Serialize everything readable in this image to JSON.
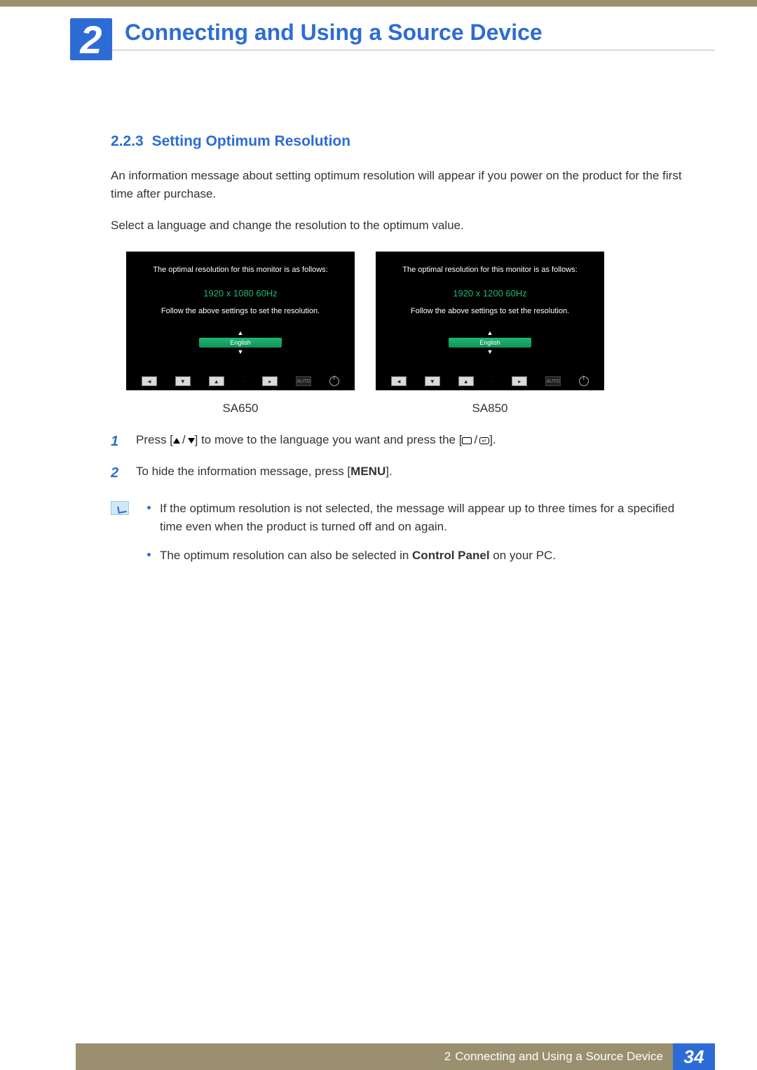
{
  "chapter": {
    "number": "2",
    "title": "Connecting and Using a Source Device"
  },
  "section": {
    "number": "2.2.3",
    "title": "Setting Optimum Resolution"
  },
  "paragraphs": {
    "p1": "An information message about setting optimum resolution will appear if you power on the product for the first time after purchase.",
    "p2": "Select a language and change the resolution to the optimum value."
  },
  "panels": [
    {
      "intro": "The optimal resolution for this monitor is as follows:",
      "resolution": "1920 x 1080  60Hz",
      "follow": "Follow the above settings to set the resolution.",
      "language": "English",
      "auto_label": "AUTO",
      "label": "SA650"
    },
    {
      "intro": "The optimal resolution for this monitor is as follows:",
      "resolution": "1920 x 1200  60Hz",
      "follow": "Follow the above settings to set the resolution.",
      "language": "English",
      "auto_label": "AUTO",
      "label": "SA850"
    }
  ],
  "steps": {
    "s1_pre": "Press [",
    "s1_mid": "] to move to the language you want and press the [",
    "s1_post": "].",
    "s2_pre": "To hide the information message, press [",
    "s2_menu": "MENU",
    "s2_post": "]."
  },
  "notes": {
    "n1": "If the optimum resolution is not selected, the message will appear up to three times for a specified time even when the product is turned off and on again.",
    "n2_pre": "The optimum resolution can also be selected in ",
    "n2_bold": "Control Panel",
    "n2_post": " on your PC."
  },
  "footer": {
    "chapter_num": "2",
    "chapter_title": "Connecting and Using a Source Device",
    "page": "34"
  }
}
